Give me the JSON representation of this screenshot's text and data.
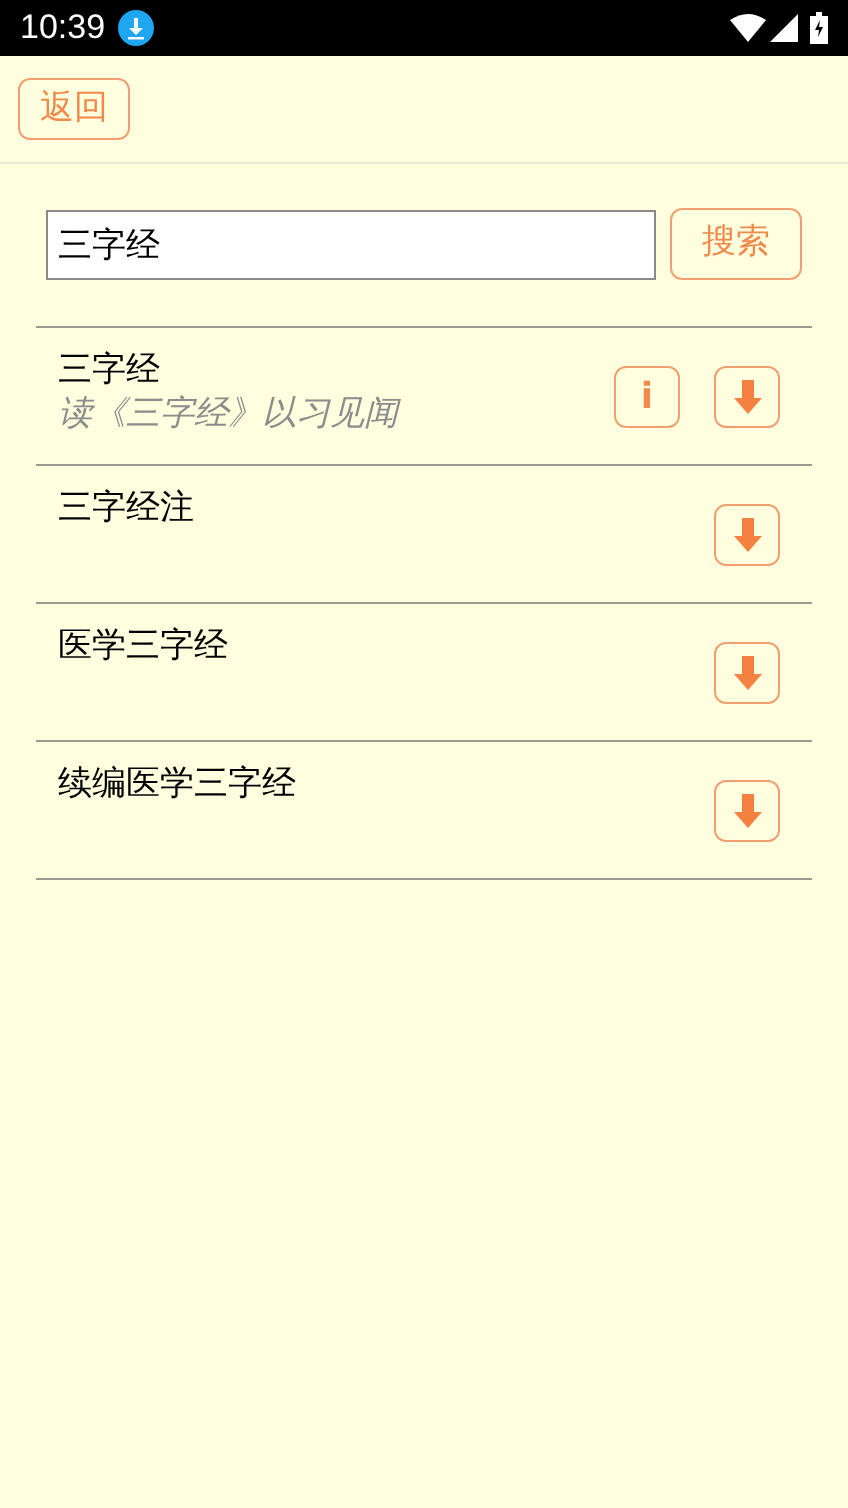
{
  "status_bar": {
    "time": "10:39"
  },
  "header": {
    "back_button": "返回"
  },
  "search": {
    "value": "三字经",
    "button": "搜索"
  },
  "results": [
    {
      "title": "三字经",
      "subtitle": "读《三字经》以习见闻",
      "info_button": "i"
    },
    {
      "title": "三字经注"
    },
    {
      "title": "医学三字经"
    },
    {
      "title": "续编医学三字经"
    }
  ]
}
